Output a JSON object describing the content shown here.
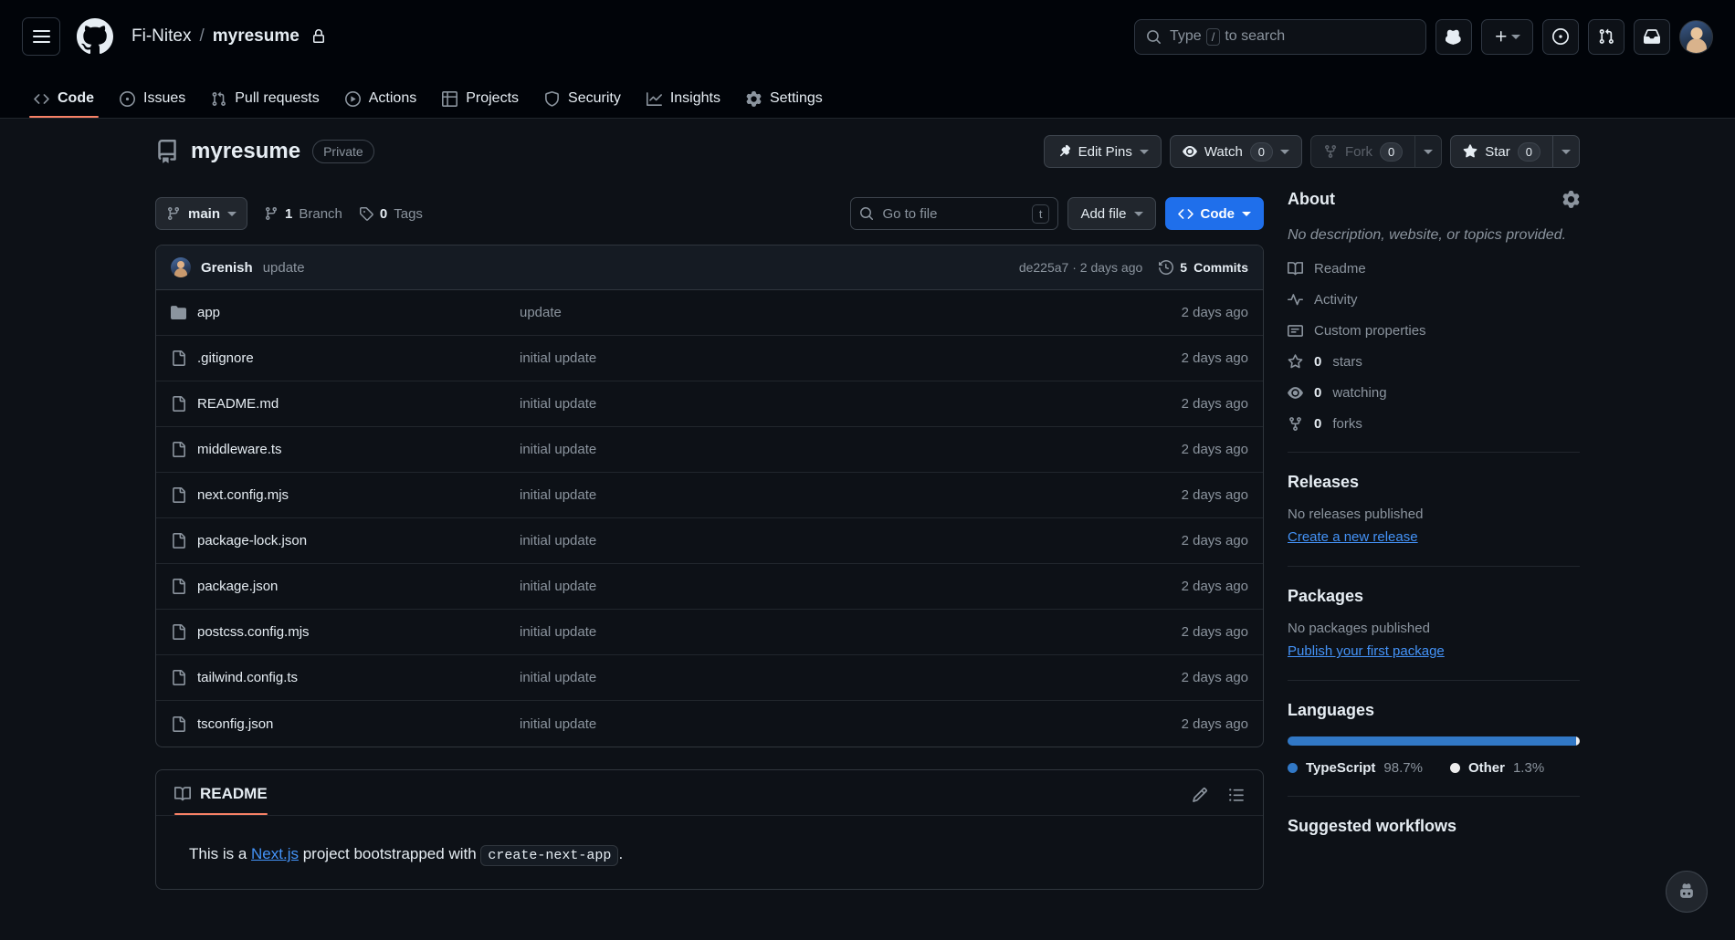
{
  "header": {
    "menu_label": "Open menu",
    "logo_name": "github-logo",
    "owner": "Fi-Nitex",
    "separator": "/",
    "repo": "myresume",
    "search_prefix": "Type",
    "search_key": "/",
    "search_suffix": "to search",
    "copilot_label": "Copilot",
    "plus_label": "Create new",
    "issues_label": "Issues",
    "pulls_label": "Pull requests",
    "inbox_label": "Notifications",
    "avatar_label": "Account menu"
  },
  "nav": {
    "tabs": [
      {
        "label": "Code",
        "icon": "code-icon",
        "active": true
      },
      {
        "label": "Issues",
        "icon": "issue-opened-icon",
        "active": false
      },
      {
        "label": "Pull requests",
        "icon": "git-pull-request-icon",
        "active": false
      },
      {
        "label": "Actions",
        "icon": "play-icon",
        "active": false
      },
      {
        "label": "Projects",
        "icon": "table-icon",
        "active": false
      },
      {
        "label": "Security",
        "icon": "shield-icon",
        "active": false
      },
      {
        "label": "Insights",
        "icon": "graph-icon",
        "active": false
      },
      {
        "label": "Settings",
        "icon": "gear-icon",
        "active": false
      }
    ]
  },
  "repo_header": {
    "name": "myresume",
    "visibility": "Private",
    "edit_pins": "Edit Pins",
    "watch": "Watch",
    "watch_count": "0",
    "fork": "Fork",
    "fork_count": "0",
    "star": "Star",
    "star_count": "0"
  },
  "toolbar": {
    "branch": "main",
    "branch_count": "1",
    "branch_label": "Branch",
    "tag_count": "0",
    "tag_label": "Tags",
    "go_to_file_placeholder": "Go to file",
    "go_to_file_key": "t",
    "add_file": "Add file",
    "code": "Code"
  },
  "commit_bar": {
    "author": "Grenish",
    "message": "update",
    "sha": "de225a7",
    "sha_sep": "·",
    "age": "2 days ago",
    "commits_count": "5",
    "commits_label": "Commits"
  },
  "files": [
    {
      "name": "app",
      "type": "folder",
      "message": "update",
      "age": "2 days ago"
    },
    {
      "name": ".gitignore",
      "type": "file",
      "message": "initial update",
      "age": "2 days ago"
    },
    {
      "name": "README.md",
      "type": "file",
      "message": "initial update",
      "age": "2 days ago"
    },
    {
      "name": "middleware.ts",
      "type": "file",
      "message": "initial update",
      "age": "2 days ago"
    },
    {
      "name": "next.config.mjs",
      "type": "file",
      "message": "initial update",
      "age": "2 days ago"
    },
    {
      "name": "package-lock.json",
      "type": "file",
      "message": "initial update",
      "age": "2 days ago"
    },
    {
      "name": "package.json",
      "type": "file",
      "message": "initial update",
      "age": "2 days ago"
    },
    {
      "name": "postcss.config.mjs",
      "type": "file",
      "message": "initial update",
      "age": "2 days ago"
    },
    {
      "name": "tailwind.config.ts",
      "type": "file",
      "message": "initial update",
      "age": "2 days ago"
    },
    {
      "name": "tsconfig.json",
      "type": "file",
      "message": "initial update",
      "age": "2 days ago"
    }
  ],
  "readme": {
    "tab_label": "README",
    "edit_label": "edit-icon",
    "outline_label": "list-unordered-icon",
    "text_before": "This is a ",
    "link_text": "Next.js",
    "text_middle": " project bootstrapped with ",
    "code_text": "create-next-app",
    "text_after": "."
  },
  "sidebar": {
    "about_title": "About",
    "settings_icon": "gear-icon",
    "description": "No description, website, or topics provided.",
    "links": [
      {
        "label": "Readme",
        "icon": "book-icon"
      },
      {
        "label": "Activity",
        "icon": "pulse-icon"
      },
      {
        "label": "Custom properties",
        "icon": "note-icon"
      }
    ],
    "stats": [
      {
        "count": "0",
        "label": "stars",
        "icon": "star-icon"
      },
      {
        "count": "0",
        "label": "watching",
        "icon": "eye-icon"
      },
      {
        "count": "0",
        "label": "forks",
        "icon": "repo-forked-icon"
      }
    ],
    "releases_title": "Releases",
    "releases_note": "No releases published",
    "releases_link": "Create a new release",
    "packages_title": "Packages",
    "packages_note": "No packages published",
    "packages_link": "Publish your first package",
    "languages_title": "Languages",
    "languages": [
      {
        "name": "TypeScript",
        "percent": "98.7%",
        "value": 98.7,
        "color": "#3178c6"
      },
      {
        "name": "Other",
        "percent": "1.3%",
        "value": 1.3,
        "color": "#ededed"
      }
    ],
    "workflows_title": "Suggested workflows"
  },
  "colors": {
    "accent": "#1f6feb",
    "link": "#4493f8",
    "underline": "#f78166",
    "bg": "#0d1117",
    "header_bg": "#010409",
    "border": "#30363d",
    "muted": "#8b949e"
  }
}
